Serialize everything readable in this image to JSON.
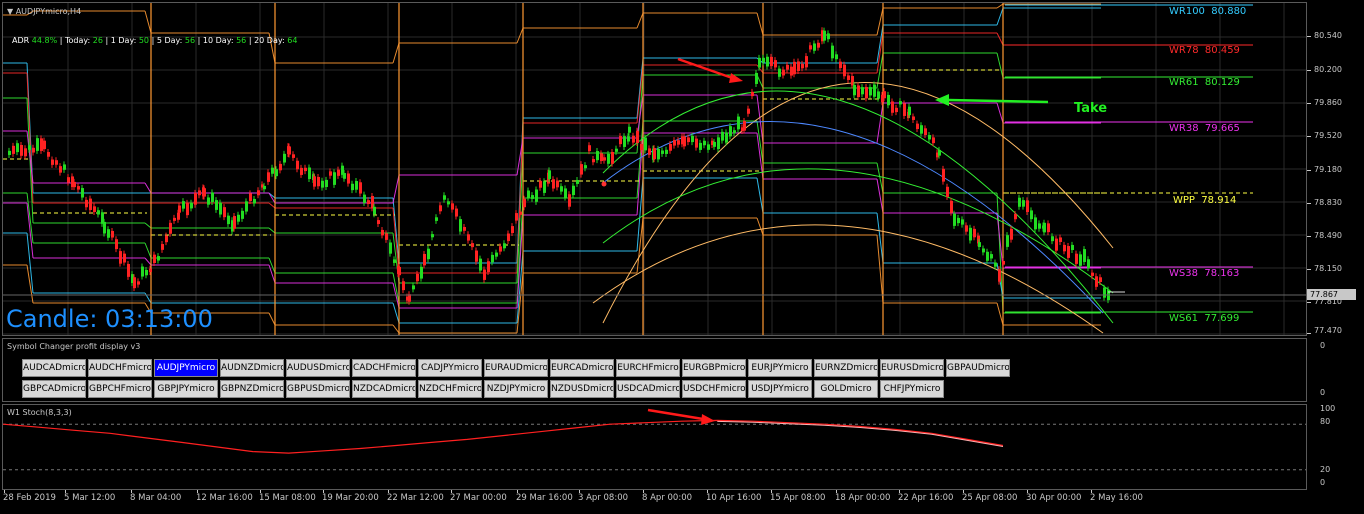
{
  "chart": {
    "symbol_title": "AUDJPYmicro,H4",
    "adr": {
      "adr_label": "ADR",
      "adr_value": "44.8%",
      "today_label": "Today:",
      "today_value": "26",
      "day1_label": "1 Day:",
      "day1_value": "50",
      "day5_label": "5 Day:",
      "day5_value": "56",
      "day10_label": "10 Day:",
      "day10_value": "56",
      "day20_label": "20 Day:",
      "day20_value": "64"
    },
    "candle_timer": "Candle:  03:13:00",
    "annotation_take": "Take",
    "current_price": "77.867",
    "pivot_labels": [
      {
        "name": "WR100",
        "value": "80.880",
        "color": "#33ccff"
      },
      {
        "name": "WR78",
        "value": "80.459",
        "color": "#ff2a2a"
      },
      {
        "name": "WR61",
        "value": "80.129",
        "color": "#33ee33"
      },
      {
        "name": "WR38",
        "value": "79.665",
        "color": "#ee33ee"
      },
      {
        "name": "WPP",
        "value": "78.914",
        "color": "#ffff44"
      },
      {
        "name": "WS38",
        "value": "78.163",
        "color": "#ee33ee"
      },
      {
        "name": "WS61",
        "value": "77.699",
        "color": "#33ee33"
      }
    ],
    "price_axis": [
      "80.540",
      "80.200",
      "79.860",
      "79.520",
      "79.180",
      "78.830",
      "78.490",
      "78.150",
      "77.810",
      "77.470"
    ]
  },
  "symbol_changer": {
    "title": "Symbol Changer profit display v3",
    "axis_zero": "0",
    "row1": [
      "AUDCADmicro",
      "AUDCHFmicro",
      "AUDJPYmicro",
      "AUDNZDmicro",
      "AUDUSDmicro",
      "CADCHFmicro",
      "CADJPYmicro",
      "EURAUDmicro",
      "EURCADmicro",
      "EURCHFmicro",
      "EURGBPmicro",
      "EURJPYmicro",
      "EURNZDmicro",
      "EURUSDmicro",
      "GBPAUDmicro"
    ],
    "row2": [
      "GBPCADmicro",
      "GBPCHFmicro",
      "GBPJPYmicro",
      "GBPNZDmicro",
      "GBPUSDmicro",
      "NZDCADmicro",
      "NZDCHFmicro",
      "NZDJPYmicro",
      "NZDUSDmicro",
      "USDCADmicro",
      "USDCHFmicro",
      "USDJPYmicro",
      "GOLDmicro",
      "CHFJPYmicro"
    ],
    "active": "AUDJPYmicro"
  },
  "stochastic": {
    "title": "W1 Stoch(8,3,3)",
    "axis": [
      "100",
      "80",
      "20",
      "0"
    ],
    "values": [
      80,
      76,
      72,
      68,
      62,
      56,
      50,
      44,
      42,
      45,
      48,
      52,
      56,
      60,
      65,
      70,
      75,
      80,
      82,
      84,
      85,
      84,
      82,
      80,
      77,
      73,
      68,
      60,
      52
    ],
    "colors": {
      "main": "#ff2020",
      "signal": "#ffb0b0"
    }
  },
  "time_axis": [
    "28 Feb 2019",
    "5 Mar 12:00",
    "8 Mar 04:00",
    "12 Mar 16:00",
    "15 Mar 08:00",
    "19 Mar 20:00",
    "22 Mar 12:00",
    "27 Mar 00:00",
    "29 Mar 16:00",
    "3 Apr 08:00",
    "8 Apr 00:00",
    "10 Apr 16:00",
    "15 Apr 08:00",
    "18 Apr 00:00",
    "22 Apr 16:00",
    "25 Apr 08:00",
    "30 Apr 00:00",
    "2 May 16:00"
  ],
  "colors": {
    "bull": "#22dd22",
    "bear": "#ff2222",
    "grid": "#2a2a2a",
    "arrow_red": "#ff1a1a",
    "arrow_green": "#22ee22",
    "timer": "#1e90ff"
  }
}
